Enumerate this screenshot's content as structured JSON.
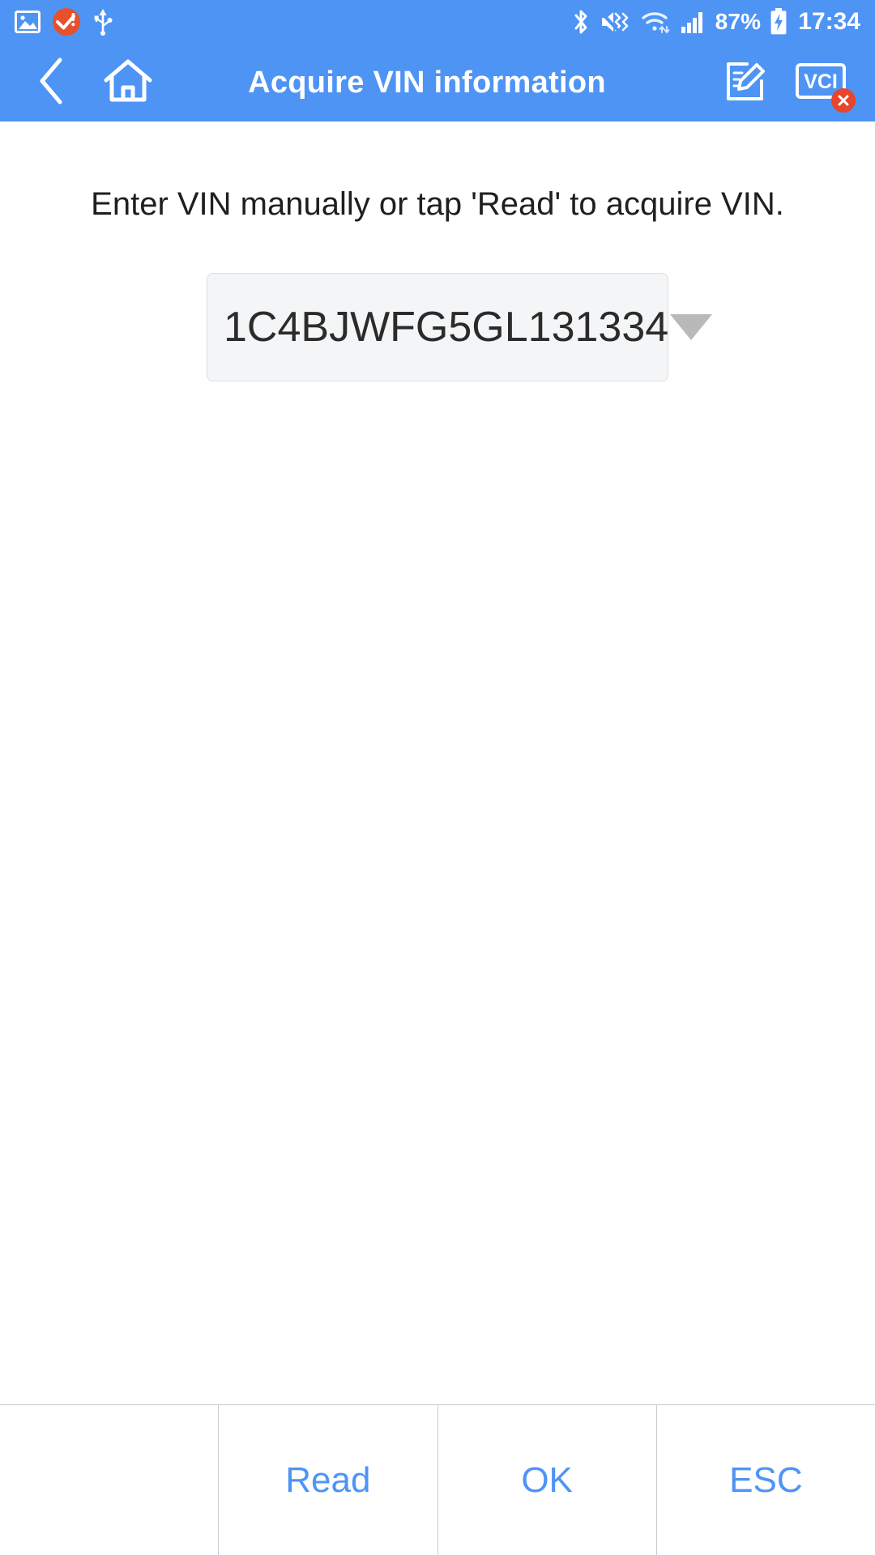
{
  "statusbar": {
    "left_icons": [
      "image-icon",
      "notification-warning-icon",
      "usb-icon"
    ],
    "right_icons": [
      "bluetooth-icon",
      "mute-vibrate-icon",
      "wifi-icon",
      "cellular-signal-icon"
    ],
    "battery_percent": "87%",
    "battery_icon": "battery-charging-icon",
    "time": "17:34",
    "background_color": "#4d94f5",
    "text_color": "#ffffff",
    "notification_badge_color": "#e8502c"
  },
  "appbar": {
    "back_icon": "back-chevron-icon",
    "home_icon": "home-icon",
    "title": "Acquire VIN information",
    "edit_icon": "edit-pencil-icon",
    "vci_label": "VCI",
    "vci_status_icon": "close-x-icon",
    "vci_status_color": "#e8452c",
    "background_color": "#4d94f5"
  },
  "main": {
    "hint_text": "Enter VIN manually or tap 'Read' to acquire VIN.",
    "vin_value": "1C4BJWFG5GL131334",
    "vin_dropdown_icon": "chevron-down-triangle-icon",
    "vin_field_background": "#f4f5f6",
    "vin_field_border": "#dcdee0"
  },
  "bottombar": {
    "buttons": [
      {
        "label": "",
        "name": "empty-cell"
      },
      {
        "label": "Read",
        "name": "read-button"
      },
      {
        "label": "OK",
        "name": "ok-button"
      },
      {
        "label": "ESC",
        "name": "esc-button"
      }
    ],
    "text_color": "#4d94f5",
    "divider_color": "#c9cbcd"
  }
}
